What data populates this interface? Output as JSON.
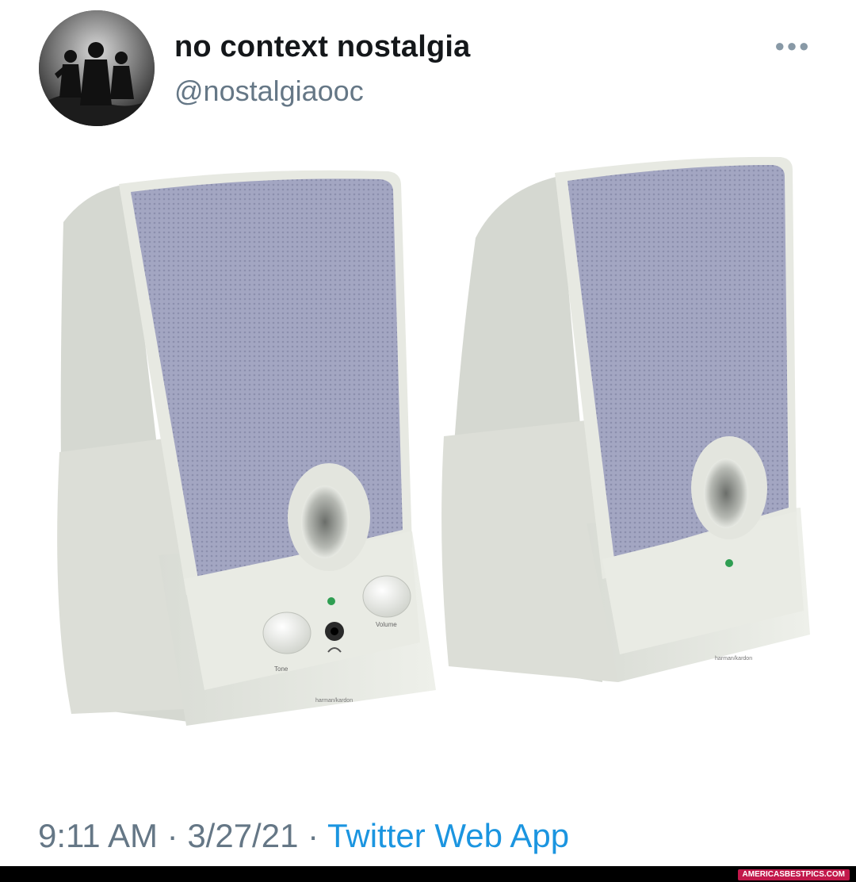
{
  "tweet": {
    "author": {
      "display_name": "no context nostalgia",
      "handle": "@nostalgiaooc"
    },
    "more_icon": "more-horizontal-icon",
    "media": {
      "speaker_left_labels": {
        "tone": "Tone",
        "volume": "Volume",
        "brand": "harman/kardon"
      },
      "speaker_right_labels": {
        "brand": "harman/kardon"
      }
    },
    "meta": {
      "time": "9:11 AM",
      "separator": " · ",
      "date": "3/27/21",
      "source": "Twitter Web App"
    }
  },
  "watermark": "AMERICASBESTPICS.COM",
  "colors": {
    "name": "#14171a",
    "secondary": "#657786",
    "link": "#1b95e0",
    "speaker_body": "#e4e7e0",
    "speaker_grille": "#a3a6c2",
    "watermark_bg": "#c2184b"
  }
}
